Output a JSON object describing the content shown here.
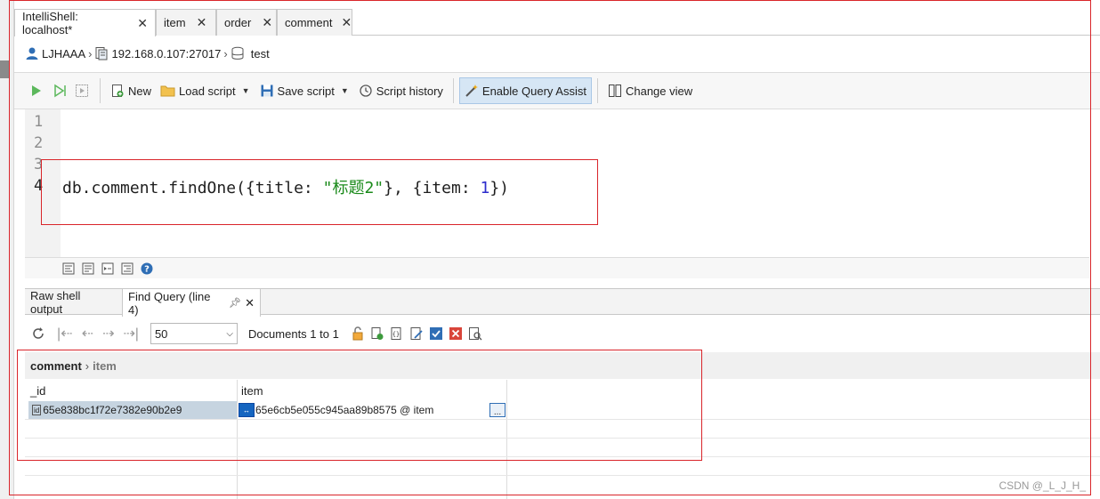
{
  "tabs": [
    {
      "label": "IntelliShell: localhost*",
      "active": true
    },
    {
      "label": "item",
      "active": false
    },
    {
      "label": "order",
      "active": false
    },
    {
      "label": "comment",
      "active": false
    }
  ],
  "breadcrumb": {
    "user": "LJHAAA",
    "server": "192.168.0.107:27017",
    "database": "test"
  },
  "toolbar": {
    "new_label": "New",
    "load_label": "Load script",
    "save_label": "Save script",
    "history_label": "Script history",
    "query_assist_label": "Enable Query Assist",
    "change_view_label": "Change view"
  },
  "editor": {
    "line_numbers": [
      "1",
      "2",
      "3",
      "4"
    ],
    "code_prefix": "db.comment.findOne({title: ",
    "code_string": "\"标题2\"",
    "code_mid": "}, {item: ",
    "code_number": "1",
    "code_suffix": "})"
  },
  "result_tabs": [
    {
      "label": "Raw shell output",
      "active": false
    },
    {
      "label": "Find Query (line 4)",
      "active": true
    }
  ],
  "result_toolbar": {
    "page_size": "50",
    "documents_label": "Documents 1 to 1"
  },
  "result_breadcrumb": {
    "collection": "comment",
    "field": "item"
  },
  "grid": {
    "columns": [
      "_id",
      "item"
    ],
    "rows": [
      {
        "id": "65e838bc1f72e7382e90b2e9",
        "item": "65e6cb5e055c945aa89b8575 @ item"
      }
    ],
    "id_badge": "id",
    "link_badge": "↔",
    "ellipsis": "..."
  },
  "watermark": "CSDN @_L_J_H_"
}
